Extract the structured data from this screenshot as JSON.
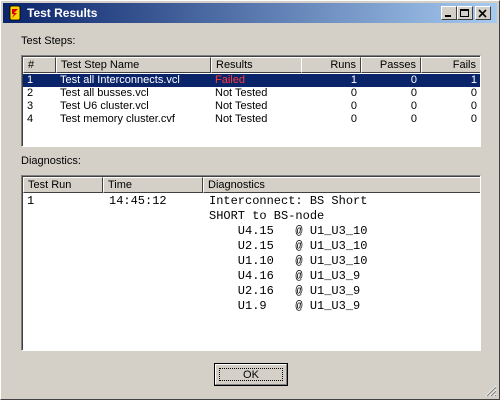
{
  "window": {
    "title": "Test Results"
  },
  "test_steps": {
    "label": "Test Steps:",
    "columns": [
      "#",
      "Test Step Name",
      "Results",
      "Runs",
      "Passes",
      "Fails"
    ],
    "rows": [
      {
        "num": "1",
        "name": "Test all Interconnects.vcl",
        "result": "Failed",
        "runs": "1",
        "passes": "0",
        "fails": "1",
        "selected": true
      },
      {
        "num": "2",
        "name": "Test all busses.vcl",
        "result": "Not Tested",
        "runs": "0",
        "passes": "0",
        "fails": "0",
        "selected": false
      },
      {
        "num": "3",
        "name": "Test U6 cluster.vcl",
        "result": "Not Tested",
        "runs": "0",
        "passes": "0",
        "fails": "0",
        "selected": false
      },
      {
        "num": "4",
        "name": "Test memory cluster.cvf",
        "result": "Not Tested",
        "runs": "0",
        "passes": "0",
        "fails": "0",
        "selected": false
      }
    ]
  },
  "diagnostics": {
    "label": "Diagnostics:",
    "columns": [
      "Test Run",
      "Time",
      "Diagnostics"
    ],
    "entry": {
      "run": "1",
      "time": "14:45:12",
      "lines": [
        "Interconnect: BS Short",
        "SHORT to BS-node",
        "    U4.15   @ U1_U3_10",
        "    U2.15   @ U1_U3_10",
        "    U1.10   @ U1_U3_10",
        "    U4.16   @ U1_U3_9",
        "    U2.16   @ U1_U3_9",
        "    U1.9    @ U1_U3_9"
      ]
    }
  },
  "buttons": {
    "ok": "OK"
  },
  "colors": {
    "title_active": "#0a246a",
    "selection": "#0a246a",
    "failed": "#ff0000",
    "face": "#d4d0c8"
  },
  "icons": [
    "app-icon",
    "minimize-icon",
    "maximize-icon",
    "close-icon",
    "resize-grip-icon"
  ]
}
